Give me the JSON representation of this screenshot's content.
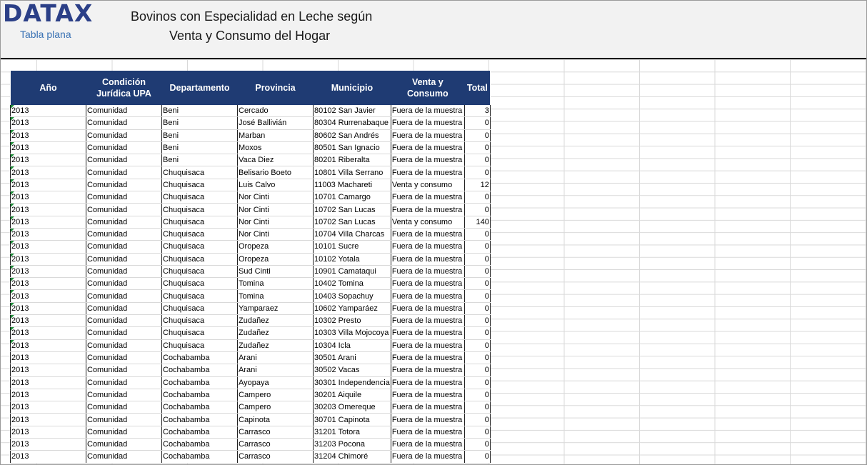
{
  "brand": {
    "logo": "DATAX",
    "subtitle": "Tabla plana"
  },
  "title": {
    "line1": "Bovinos con Especialidad en Leche según",
    "line2": "Venta y Consumo del Hogar"
  },
  "columns": [
    "Año",
    "Condición Jurídica UPA",
    "Departamento",
    "Provincia",
    "Municipio",
    "Venta y Consumo",
    "Total"
  ],
  "rows": [
    [
      "2013",
      "Comunidad",
      "Beni",
      "Cercado",
      "80102 San Javier",
      "Fuera de la muestra",
      "3"
    ],
    [
      "2013",
      "Comunidad",
      "Beni",
      "José Ballivián",
      "80304 Rurrenabaque",
      "Fuera de la muestra",
      "0"
    ],
    [
      "2013",
      "Comunidad",
      "Beni",
      "Marban",
      "80602 San Andrés",
      "Fuera de la muestra",
      "0"
    ],
    [
      "2013",
      "Comunidad",
      "Beni",
      "Moxos",
      "80501 San Ignacio",
      "Fuera de la muestra",
      "0"
    ],
    [
      "2013",
      "Comunidad",
      "Beni",
      "Vaca Diez",
      "80201 Riberalta",
      "Fuera de la muestra",
      "0"
    ],
    [
      "2013",
      "Comunidad",
      "Chuquisaca",
      "Belisario Boeto",
      "10801 Villa Serrano",
      "Fuera de la muestra",
      "0"
    ],
    [
      "2013",
      "Comunidad",
      "Chuquisaca",
      "Luis Calvo",
      "11003 Machareti",
      "Venta y consumo",
      "12"
    ],
    [
      "2013",
      "Comunidad",
      "Chuquisaca",
      "Nor Cinti",
      "10701 Camargo",
      "Fuera de la muestra",
      "0"
    ],
    [
      "2013",
      "Comunidad",
      "Chuquisaca",
      "Nor Cinti",
      "10702 San Lucas",
      "Fuera de la muestra",
      "0"
    ],
    [
      "2013",
      "Comunidad",
      "Chuquisaca",
      "Nor Cinti",
      "10702 San Lucas",
      "Venta y consumo",
      "140"
    ],
    [
      "2013",
      "Comunidad",
      "Chuquisaca",
      "Nor Cinti",
      "10704 Villa Charcas",
      "Fuera de la muestra",
      "0"
    ],
    [
      "2013",
      "Comunidad",
      "Chuquisaca",
      "Oropeza",
      "10101 Sucre",
      "Fuera de la muestra",
      "0"
    ],
    [
      "2013",
      "Comunidad",
      "Chuquisaca",
      "Oropeza",
      "10102 Yotala",
      "Fuera de la muestra",
      "0"
    ],
    [
      "2013",
      "Comunidad",
      "Chuquisaca",
      "Sud Cinti",
      "10901 Camataqui",
      "Fuera de la muestra",
      "0"
    ],
    [
      "2013",
      "Comunidad",
      "Chuquisaca",
      "Tomina",
      "10402 Tomina",
      "Fuera de la muestra",
      "0"
    ],
    [
      "2013",
      "Comunidad",
      "Chuquisaca",
      "Tomina",
      "10403 Sopachuy",
      "Fuera de la muestra",
      "0"
    ],
    [
      "2013",
      "Comunidad",
      "Chuquisaca",
      "Yamparaez",
      "10602 Yamparáez",
      "Fuera de la muestra",
      "0"
    ],
    [
      "2013",
      "Comunidad",
      "Chuquisaca",
      "Zudañez",
      "10302 Presto",
      "Fuera de la muestra",
      "0"
    ],
    [
      "2013",
      "Comunidad",
      "Chuquisaca",
      "Zudañez",
      "10303 Villa Mojocoya",
      "Fuera de la muestra",
      "0"
    ],
    [
      "2013",
      "Comunidad",
      "Chuquisaca",
      "Zudañez",
      "10304 Icla",
      "Fuera de la muestra",
      "0"
    ],
    [
      "2013",
      "Comunidad",
      "Cochabamba",
      "Arani",
      "30501 Arani",
      "Fuera de la muestra",
      "0"
    ],
    [
      "2013",
      "Comunidad",
      "Cochabamba",
      "Arani",
      "30502 Vacas",
      "Fuera de la muestra",
      "0"
    ],
    [
      "2013",
      "Comunidad",
      "Cochabamba",
      "Ayopaya",
      "30301 Independencia",
      "Fuera de la muestra",
      "0"
    ],
    [
      "2013",
      "Comunidad",
      "Cochabamba",
      "Campero",
      "30201 Aiquile",
      "Fuera de la muestra",
      "0"
    ],
    [
      "2013",
      "Comunidad",
      "Cochabamba",
      "Campero",
      "30203 Omereque",
      "Fuera de la muestra",
      "0"
    ],
    [
      "2013",
      "Comunidad",
      "Cochabamba",
      "Capinota",
      "30701 Capinota",
      "Fuera de la muestra",
      "0"
    ],
    [
      "2013",
      "Comunidad",
      "Cochabamba",
      "Carrasco",
      "31201 Totora",
      "Fuera de la muestra",
      "0"
    ],
    [
      "2013",
      "Comunidad",
      "Cochabamba",
      "Carrasco",
      "31203 Pocona",
      "Fuera de la muestra",
      "0"
    ],
    [
      "2013",
      "Comunidad",
      "Cochabamba",
      "Carrasco",
      "31204 Chimoré",
      "Fuera de la muestra",
      "0"
    ]
  ],
  "colors": {
    "header_bg": "#1f3b73",
    "logo": "#2b3f87",
    "logo_sub": "#3a72b4",
    "cell_marker": "#1e8f3a"
  }
}
